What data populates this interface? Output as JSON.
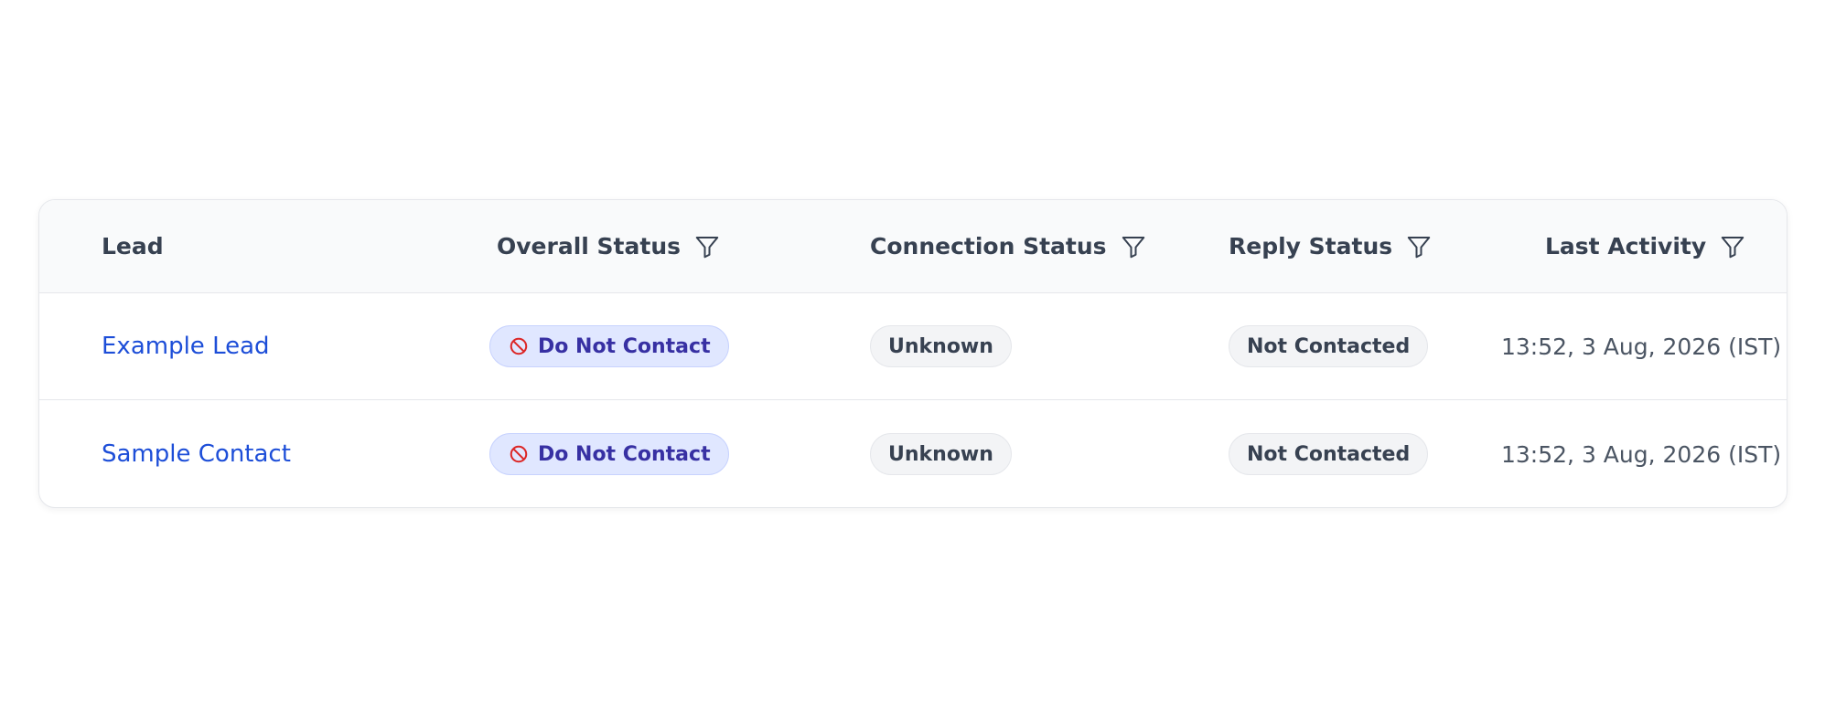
{
  "table": {
    "columns": [
      {
        "label": "Lead",
        "filterable": false
      },
      {
        "label": "Overall Status",
        "filterable": true
      },
      {
        "label": "Connection Status",
        "filterable": true
      },
      {
        "label": "Reply Status",
        "filterable": true
      },
      {
        "label": "Last Activity",
        "filterable": true
      }
    ],
    "rows": [
      {
        "lead": "Example Lead",
        "overall_status": "Do Not Contact",
        "connection_status": "Unknown",
        "reply_status": "Not Contacted",
        "last_activity": "13:52, 3 Aug, 2026 (IST)"
      },
      {
        "lead": "Sample Contact",
        "overall_status": "Do Not Contact",
        "connection_status": "Unknown",
        "reply_status": "Not Contacted",
        "last_activity": "13:52, 3 Aug, 2026 (IST)"
      }
    ]
  },
  "icons": {
    "filter": "filter-funnel-icon",
    "do_not_contact": "ban-icon"
  },
  "colors": {
    "link": "#1d4ed8",
    "dnc_badge_bg": "#e0e7ff",
    "dnc_badge_text": "#3730a3",
    "dnc_icon": "#dc2626",
    "neutral_badge_bg": "#f3f4f6"
  }
}
